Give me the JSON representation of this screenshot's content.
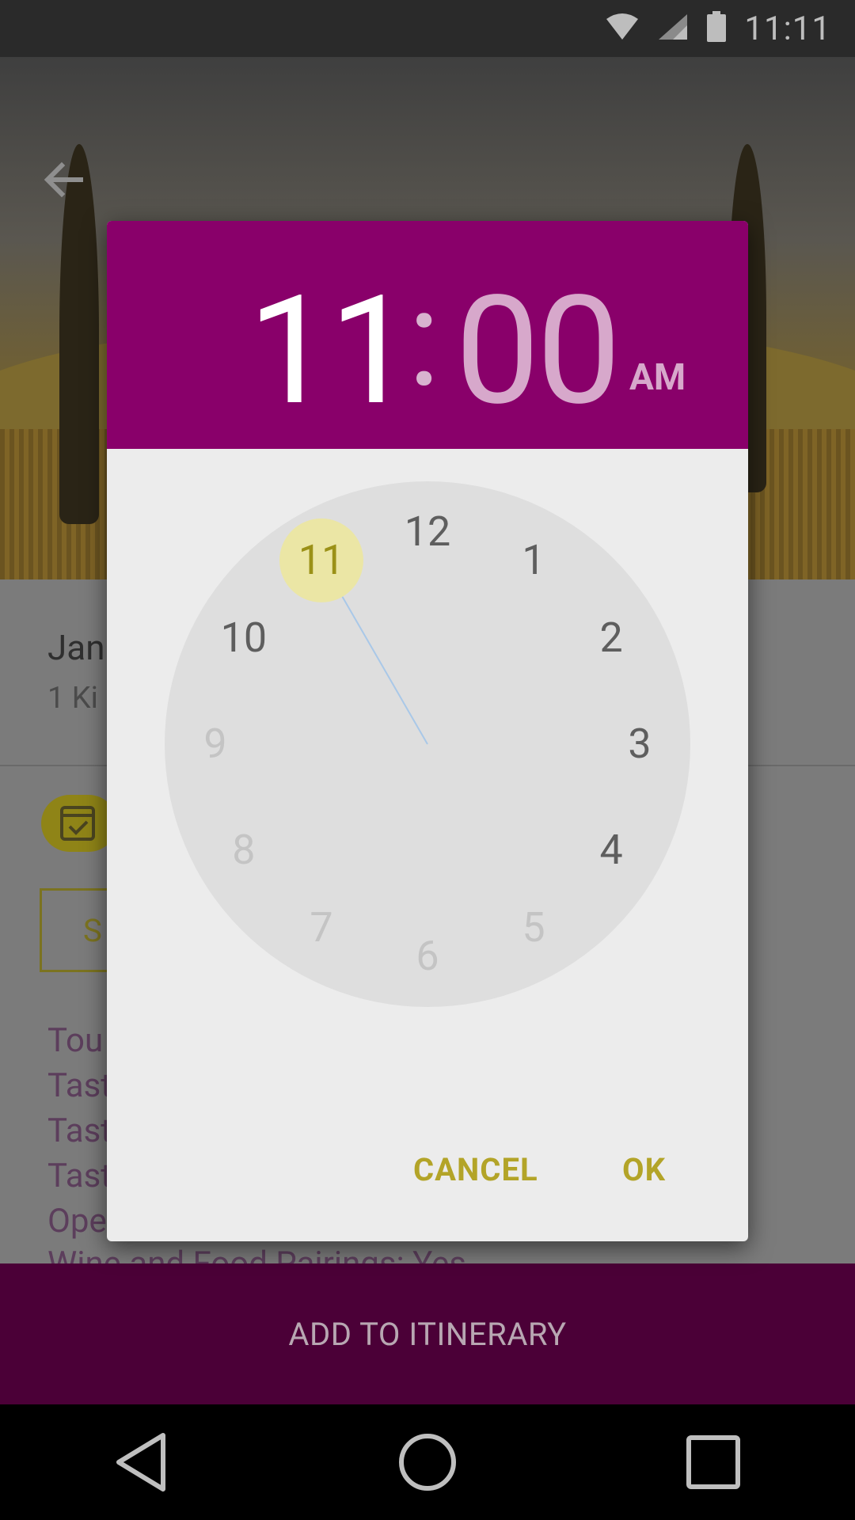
{
  "status_bar": {
    "time": "11:11"
  },
  "content": {
    "title_partial": "Jan",
    "subtitle_partial": "1 Ki",
    "outline_button_partial": "S",
    "info_lines": [
      "Tou",
      "Tast",
      "Tast",
      "Tast",
      "Ope",
      "Wine and Food Pairings:     Yes"
    ]
  },
  "action_bar": {
    "label": "ADD TO ITINERARY"
  },
  "time_picker": {
    "hour": "11",
    "separator": ":",
    "minute": "00",
    "ampm": "AM",
    "selected_hour": 11,
    "hours": [
      "12",
      "1",
      "2",
      "3",
      "4",
      "5",
      "6",
      "7",
      "8",
      "9",
      "10",
      "11"
    ],
    "cancel_label": "CANCEL",
    "ok_label": "OK"
  },
  "colors": {
    "header": "#89006a",
    "accent": "#b3a428",
    "action_bar": "#4b0037",
    "selector": "#ebe6a5"
  }
}
